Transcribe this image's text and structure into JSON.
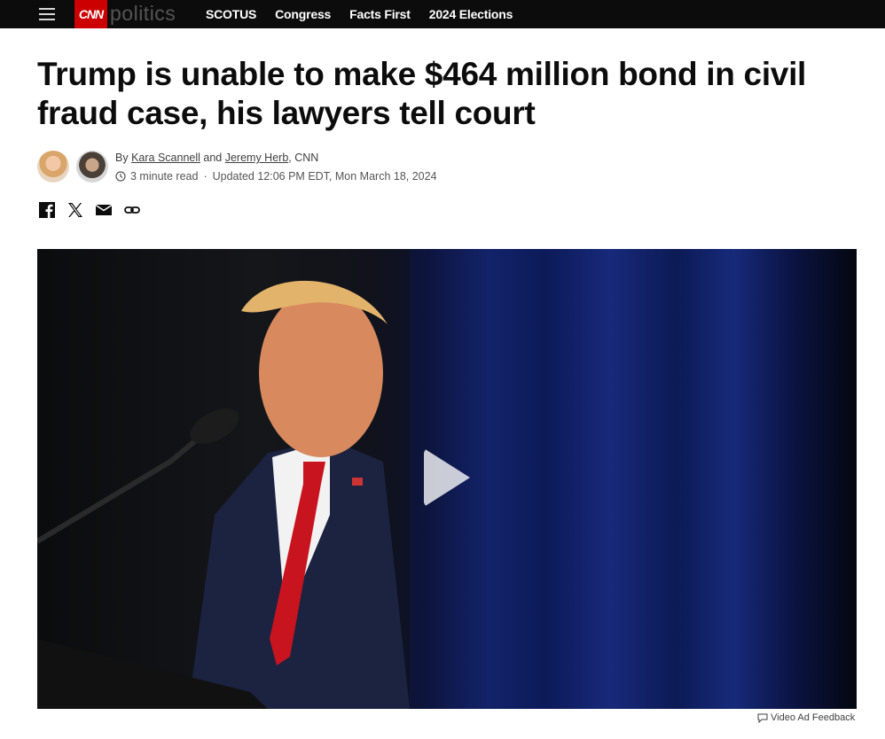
{
  "header": {
    "brand_logo": "CNN",
    "section": "politics",
    "nav": [
      "SCOTUS",
      "Congress",
      "Facts First",
      "2024 Elections"
    ]
  },
  "article": {
    "headline": "Trump is unable to make $464 million bond in civil fraud case, his lawyers tell court",
    "byline": {
      "prefix": "By",
      "author1": "Kara Scannell",
      "conjunction": "and",
      "author2": "Jeremy Herb",
      "outlet": ", CNN"
    },
    "read_time": "3 minute read",
    "separator": "·",
    "updated": "Updated 12:06 PM EDT, Mon March 18, 2024"
  },
  "share_icons": [
    "facebook-icon",
    "x-icon",
    "email-icon",
    "link-icon"
  ],
  "video": {
    "ad_feedback": "Video Ad Feedback"
  },
  "colors": {
    "topbar": "#0c0c0c",
    "brand_red": "#cc0000",
    "text": "#0c0c0c"
  }
}
